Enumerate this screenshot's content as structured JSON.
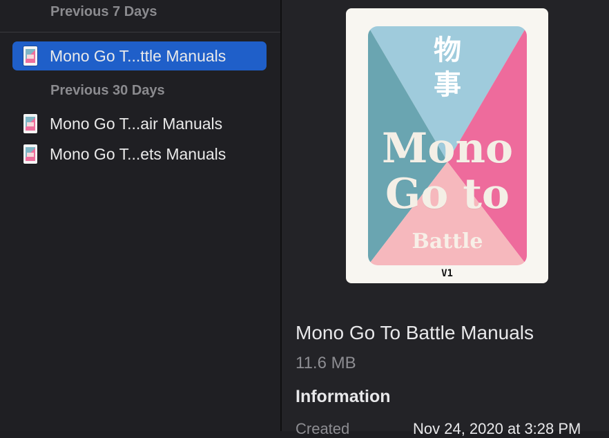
{
  "sidebar": {
    "sections": [
      {
        "header": "Previous 7 Days"
      },
      {
        "header": "Previous 30 Days"
      }
    ],
    "files": [
      {
        "name": "Mono Go T...ttle Manuals",
        "selected": true
      },
      {
        "name": "Mono Go T...air Manuals",
        "selected": false
      },
      {
        "name": "Mono Go T...ets Manuals",
        "selected": false
      }
    ]
  },
  "preview": {
    "cover": {
      "cjk": [
        "物",
        "事"
      ],
      "title_lines": [
        "Mono",
        "Go to"
      ],
      "subtitle": "Battle",
      "version": "V1",
      "colors": {
        "teal": "#6aa5b1",
        "light_blue": "#9fcbdc",
        "pink": "#ee6b9c",
        "peach": "#f6b8bd",
        "paper": "#f8f6f1"
      }
    },
    "title": "Mono Go To Battle Manuals",
    "size": "11.6 MB",
    "info_heading": "Information",
    "created_label": "Created",
    "created_value": "Nov 24, 2020 at 3:28 PM"
  },
  "colors": {
    "accent": "#1f5fc9",
    "background": "#1f1f23"
  }
}
